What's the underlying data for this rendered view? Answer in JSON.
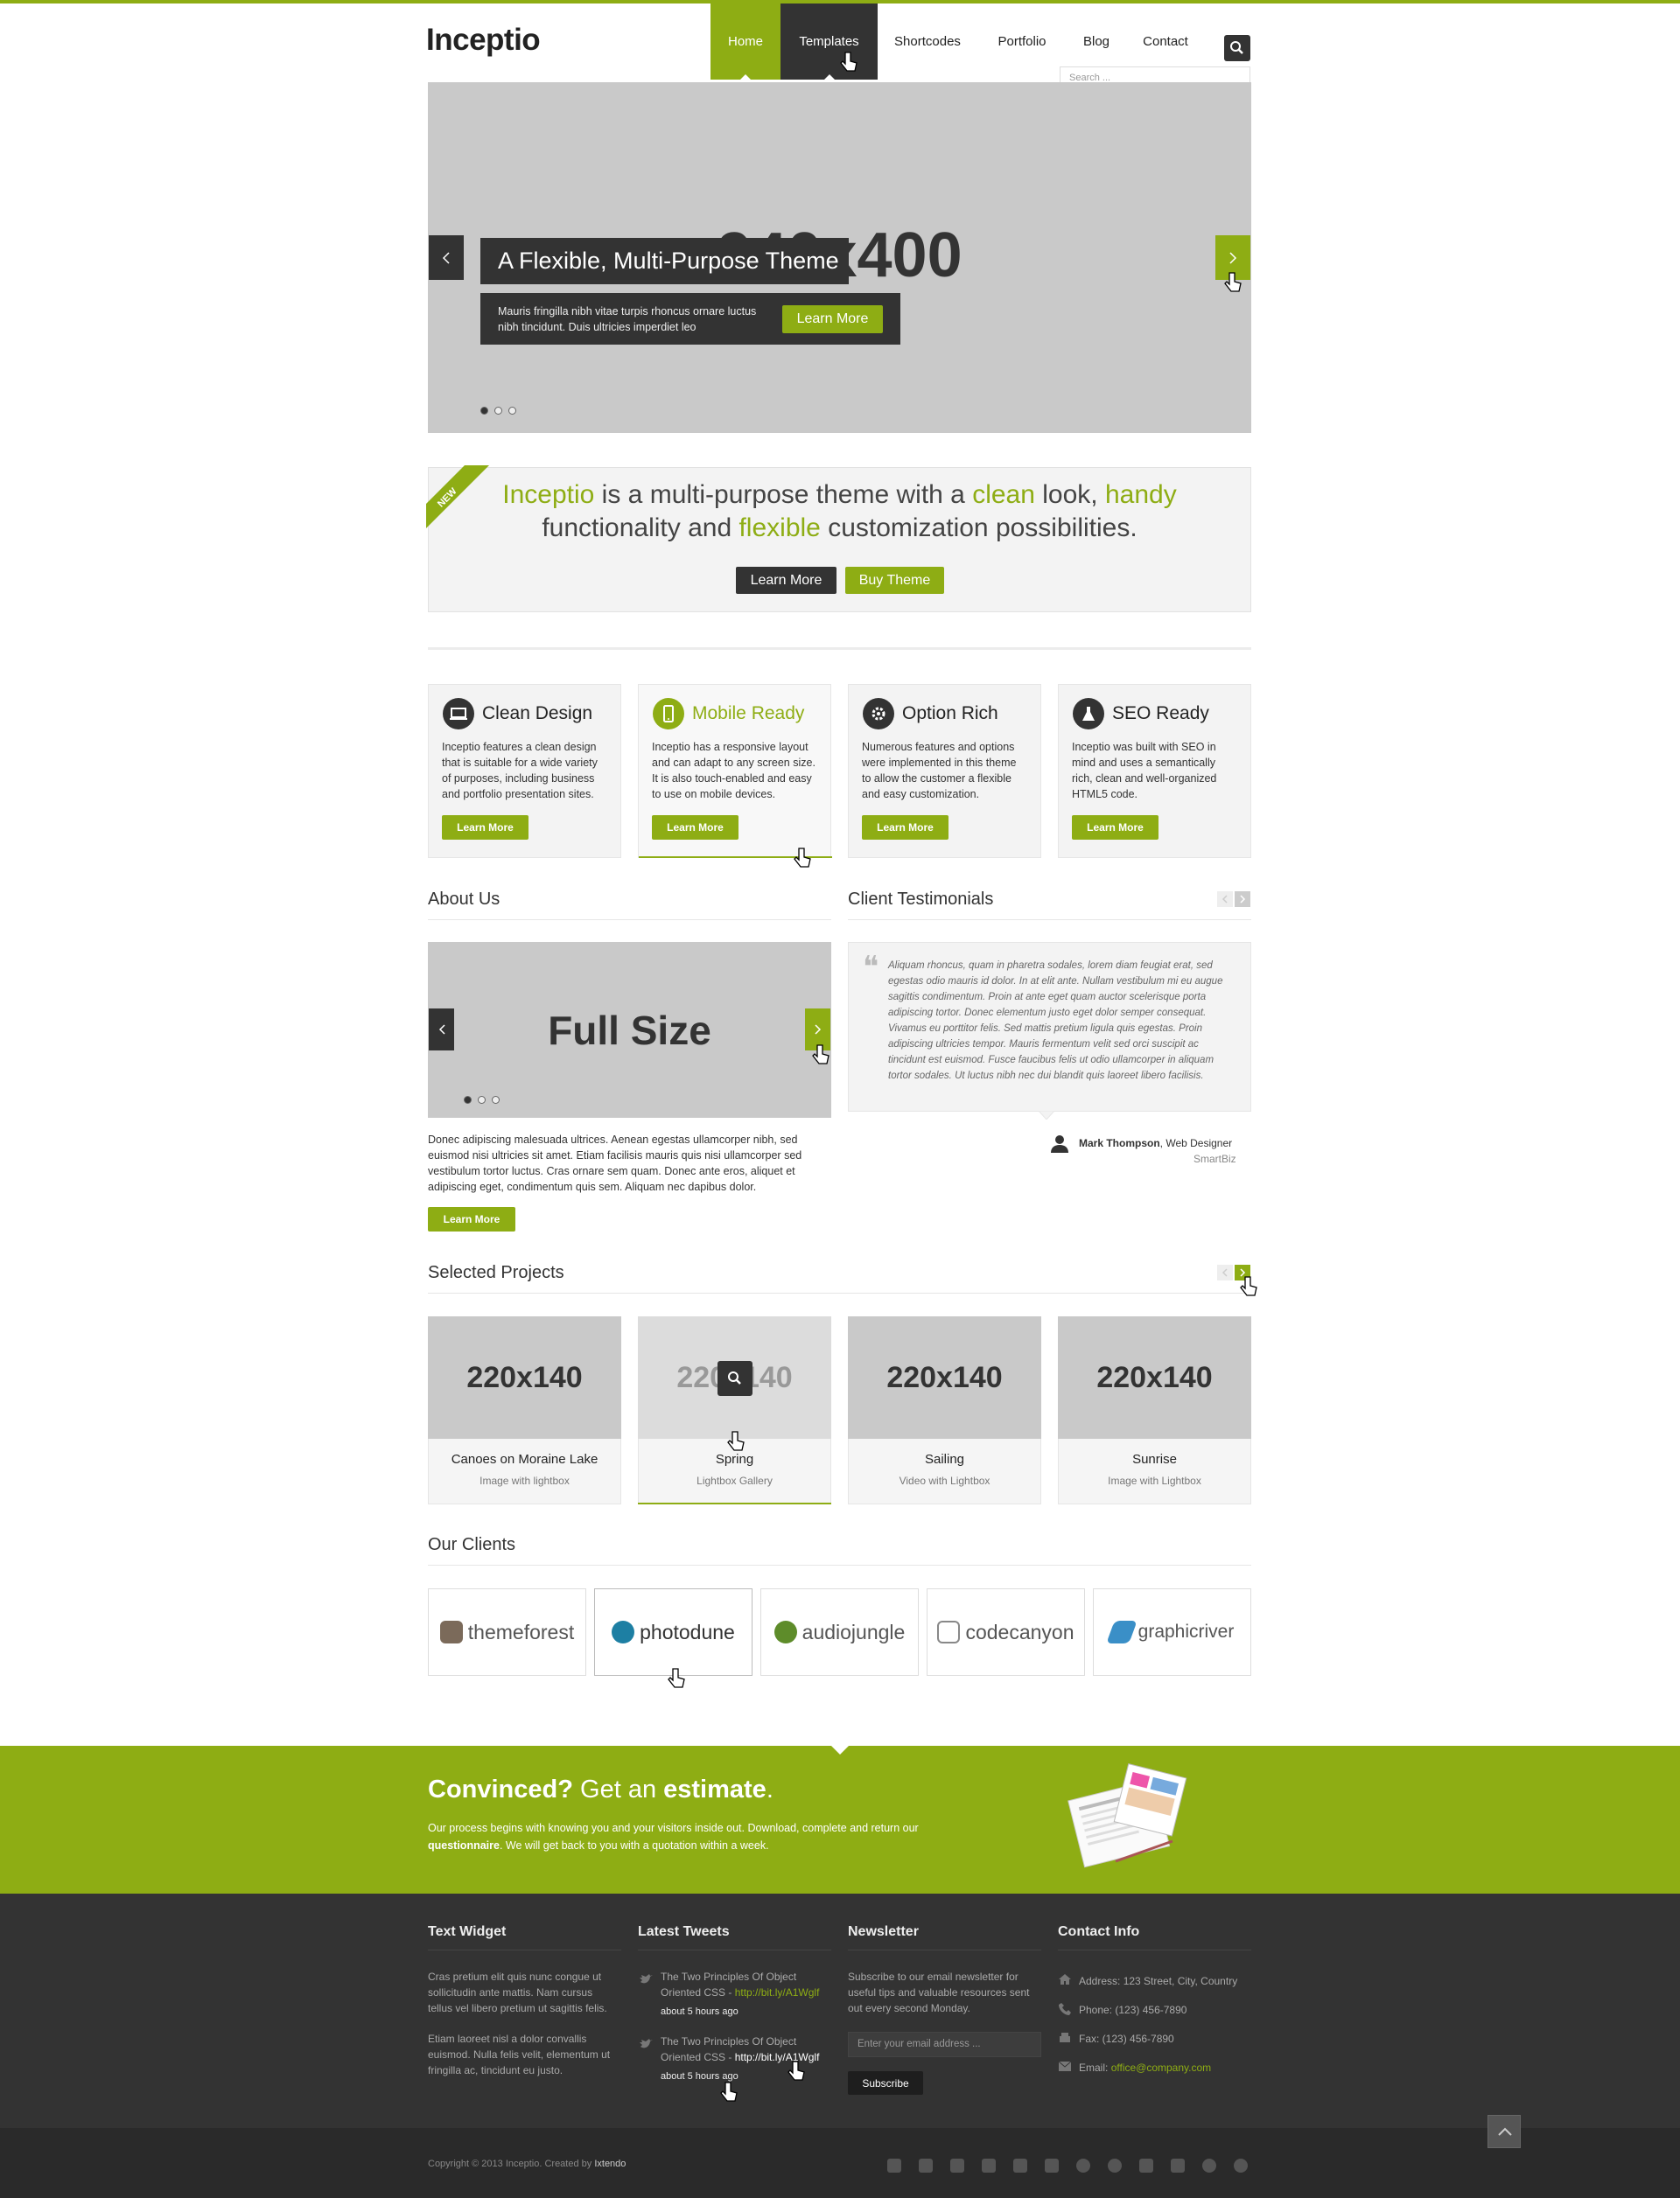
{
  "brand": {
    "logo": "Inceptio",
    "accent": "#8ead14",
    "dark": "#333333"
  },
  "nav": {
    "items": [
      {
        "label": "Home",
        "state": "active"
      },
      {
        "label": "Templates",
        "state": "hover"
      },
      {
        "label": "Shortcodes",
        "state": "normal"
      },
      {
        "label": "Portfolio",
        "state": "normal"
      },
      {
        "label": "Blog",
        "state": "normal"
      },
      {
        "label": "Contact",
        "state": "normal"
      }
    ],
    "search_placeholder": "Search ..."
  },
  "slider": {
    "placeholder": "940x400",
    "caption_title": "A Flexible, Multi-Purpose Theme",
    "caption_text": "Mauris fringilla nibh vitae turpis rhoncus ornare luctus nibh tincidunt. Duis ultricies imperdiet leo",
    "cta": "Learn More",
    "active_dot": 1
  },
  "promo": {
    "ribbon": "NEW",
    "line1": {
      "a": "Inceptio",
      "b": " is a multi-purpose theme with a ",
      "c": "clean",
      "d": " look, ",
      "e": "handy"
    },
    "line2": {
      "a": "functionality and ",
      "b": "flexible",
      "c": " customization possibilities."
    },
    "btn_primary": "Learn More",
    "btn_secondary": "Buy Theme"
  },
  "features": [
    {
      "icon": "laptop-icon",
      "title": "Clean Design",
      "text": "Inceptio features a clean design that is suitable for a wide variety of purposes, including business and portfolio presentation sites.",
      "btn": "Learn More",
      "active": false
    },
    {
      "icon": "mobile-icon",
      "title": "Mobile Ready",
      "text": "Inceptio has a responsive layout and can adapt to any screen size. It is also touch-enabled and easy to use on mobile devices.",
      "btn": "Learn More",
      "active": true
    },
    {
      "icon": "gear-icon",
      "title": "Option Rich",
      "text": "Numerous features and options were implemented in this theme to allow the customer a flexible and easy customization.",
      "btn": "Learn More",
      "active": false
    },
    {
      "icon": "flask-icon",
      "title": "SEO Ready",
      "text": "Inceptio was built with SEO in mind and uses a semantically rich, clean and well-organized HTML5 code.",
      "btn": "Learn More",
      "active": false
    }
  ],
  "about": {
    "title": "About Us",
    "image_label": "Full Size",
    "text": "Donec adipiscing malesuada ultrices. Aenean egestas ullamcorper nibh, sed euismod nisi ultricies sit amet. Etiam facilisis mauris quis nisi ullamcorper sed vestibulum tortor luctus. Cras ornare sem quam. Donec ante eros, aliquet et adipiscing eget, condimentum quis sem. Aliquam nec dapibus dolor.",
    "btn": "Learn More"
  },
  "testimonials": {
    "title": "Client Testimonials",
    "quote": "Aliquam rhoncus, quam in pharetra sodales, lorem diam feugiat erat, sed egestas odio mauris id dolor. In at elit ante. Nullam vestibulum mi eu augue sagittis condimentum. Proin at ante eget quam auctor scelerisque porta adipiscing tortor. Donec elementum justo eget dolor semper consequat. Vivamus eu porttitor felis. Sed mattis pretium ligula quis egestas. Proin adipiscing ultricies tempor. Mauris fermentum velit sed orci suscipit ac tincidunt est euismod. Fusce faucibus felis ut odio ullamcorper in aliquam tortor sodales. Ut luctus nibh nec dui blandit quis laoreet libero facilisis.",
    "author": "Mark Thompson",
    "role": ", Web Designer",
    "company": "SmartBiz"
  },
  "projects": {
    "title": "Selected Projects",
    "items": [
      {
        "thumb": "220x140",
        "title": "Canoes on Moraine Lake",
        "sub": "Image with lightbox"
      },
      {
        "thumb": "220x140",
        "title": "Spring",
        "sub": "Lightbox Gallery"
      },
      {
        "thumb": "220x140",
        "title": "Sailing",
        "sub": "Video with Lightbox"
      },
      {
        "thumb": "220x140",
        "title": "Sunrise",
        "sub": "Image with Lightbox"
      }
    ]
  },
  "clients": {
    "title": "Our Clients",
    "items": [
      {
        "name": "themeforest",
        "icon": "themeforest-icon",
        "color": "#7b6a5a"
      },
      {
        "name": "photodune",
        "icon": "photodune-icon",
        "color": "#1d7fa3"
      },
      {
        "name": "audiojungle",
        "icon": "audiojungle-icon",
        "color": "#5e8c2a"
      },
      {
        "name": "codecanyon",
        "icon": "codecanyon-icon",
        "color": "#888888"
      },
      {
        "name": "graphicriver",
        "icon": "graphicriver-icon",
        "color": "#3a8fc7"
      }
    ]
  },
  "cta": {
    "t1": "Convinced?",
    "t2": " Get an ",
    "t3": "estimate",
    "t4": ".",
    "text_a": "Our process begins with knowing you and your visitors inside out. Download, complete and return our",
    "text_b": "questionnaire",
    "text_c": ". We will get back to you with a quotation within a week."
  },
  "footer": {
    "text_widget": {
      "title": "Text Widget",
      "p1": "Cras pretium elit quis nunc congue ut sollicitudin ante mattis. Nam cursus tellus vel libero pretium ut sagittis felis.",
      "p2": "Etiam laoreet nisl a dolor convallis euismod. Nulla felis velit, elementum ut fringilla ac, tincidunt eu justo."
    },
    "tweets": {
      "title": "Latest Tweets",
      "items": [
        {
          "text": "The Two Principles Of Object Oriented CSS - ",
          "link": "http://bit.ly/A1Wglf",
          "time": "about 5 hours ago"
        },
        {
          "text": "The Two Principles Of Object Oriented CSS - ",
          "link": "http://bit.ly/A1Wglf",
          "time": "about 5 hours ago"
        }
      ]
    },
    "newsletter": {
      "title": "Newsletter",
      "text": "Subscribe to our email newsletter for useful tips and valuable resources sent out every second Monday.",
      "placeholder": "Enter your email address ...",
      "btn": "Subscribe"
    },
    "contact": {
      "title": "Contact Info",
      "address": "Address: 123 Street, City, Country",
      "phone": "Phone: (123) 456-7890",
      "fax": "Fax: (123) 456-7890",
      "email_label": "Email: ",
      "email": "office@company.com"
    }
  },
  "bottom": {
    "copyright": "Copyright © 2013 Inceptio. Created by ",
    "creator": "Ixtendo",
    "social": [
      "twitter-icon",
      "facebook-icon",
      "googleplus-icon",
      "linkedin-icon",
      "vimeo-icon",
      "youtube-icon",
      "skype-icon",
      "pinterest-icon",
      "flickr-icon",
      "tumblr-icon",
      "dribbble-icon",
      "rss-icon"
    ]
  }
}
